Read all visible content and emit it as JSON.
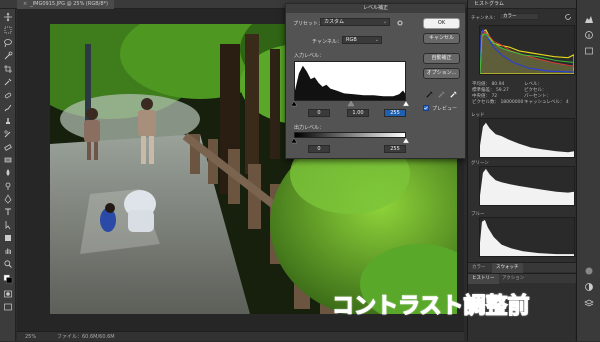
{
  "document": {
    "tab_title": "_IMG0915.JPG @ 25% (RGB/8*)",
    "zoom": "25%",
    "file_info": "ファイル：60.6M/60.6M"
  },
  "levels_dialog": {
    "title": "レベル補正",
    "preset_label": "プリセット：",
    "preset_value": "カスタム",
    "channel_label": "チャンネル：",
    "channel_value": "RGB",
    "input_levels_label": "入力レベル：",
    "input_black": "0",
    "input_gamma": "1.00",
    "input_white": "255",
    "output_levels_label": "出力レベル：",
    "output_black": "0",
    "output_white": "255",
    "ok_label": "OK",
    "cancel_label": "キャンセル",
    "auto_label": "自動補正",
    "options_label": "オプション...",
    "preview_label": "プレビュー",
    "preview_checked": true
  },
  "histogram_panel": {
    "title": "ヒストグラム",
    "channel_label": "チャンネル：",
    "channel_value": "カラー",
    "stats_left": [
      {
        "label": "平均値：",
        "value": "80.94"
      },
      {
        "label": "標準偏差：",
        "value": "59.27"
      },
      {
        "label": "中央値：",
        "value": "72"
      },
      {
        "label": "ピクセル数：",
        "value": "18000000"
      }
    ],
    "stats_right": [
      {
        "label": "レベル：",
        "value": ""
      },
      {
        "label": "ピクセル：",
        "value": ""
      },
      {
        "label": "パーセント：",
        "value": ""
      },
      {
        "label": "キャッシュレベル：",
        "value": "4"
      }
    ],
    "label_red": "レッド",
    "label_green": "グリーン",
    "label_blue": "ブルー",
    "tabs_a": [
      "カラー",
      "スウォッチ"
    ],
    "tabs_b": [
      "ヒストリー",
      "アクション"
    ],
    "bottom_item": "レイヤー"
  },
  "caption": "コントラスト調整前",
  "colors": {
    "caption": "#ff3a5c",
    "accent": "#1f5fb0"
  }
}
